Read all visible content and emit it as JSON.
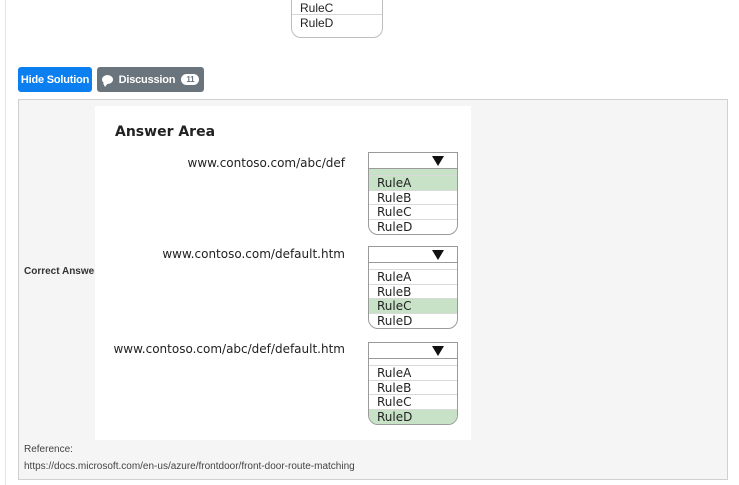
{
  "top_dropdown": {
    "options": [
      "RuleC",
      "RuleD"
    ]
  },
  "buttons": {
    "hide_solution": "Hide Solution",
    "discussion": "Discussion",
    "discussion_count": "11"
  },
  "panel": {
    "correct_answer_label": "Correct Answer:",
    "answer_area": {
      "title": "Answer Area",
      "rows": [
        {
          "url": "www.contoso.com/abc/def",
          "options": [
            "RuleA",
            "RuleB",
            "RuleC",
            "RuleD"
          ],
          "selected": "RuleA"
        },
        {
          "url": "www.contoso.com/default.htm",
          "options": [
            "RuleA",
            "RuleB",
            "RuleC",
            "RuleD"
          ],
          "selected": "RuleC"
        },
        {
          "url": "www.contoso.com/abc/def/default.htm",
          "options": [
            "RuleA",
            "RuleB",
            "RuleC",
            "RuleD"
          ],
          "selected": "RuleD"
        }
      ]
    },
    "reference_label": "Reference:",
    "reference_url": "https://docs.microsoft.com/en-us/azure/frontdoor/front-door-route-matching"
  },
  "colors": {
    "primary_button": "#0b7ff0",
    "secondary_button": "#6a747c",
    "selected_option": "#c7e2c7"
  }
}
